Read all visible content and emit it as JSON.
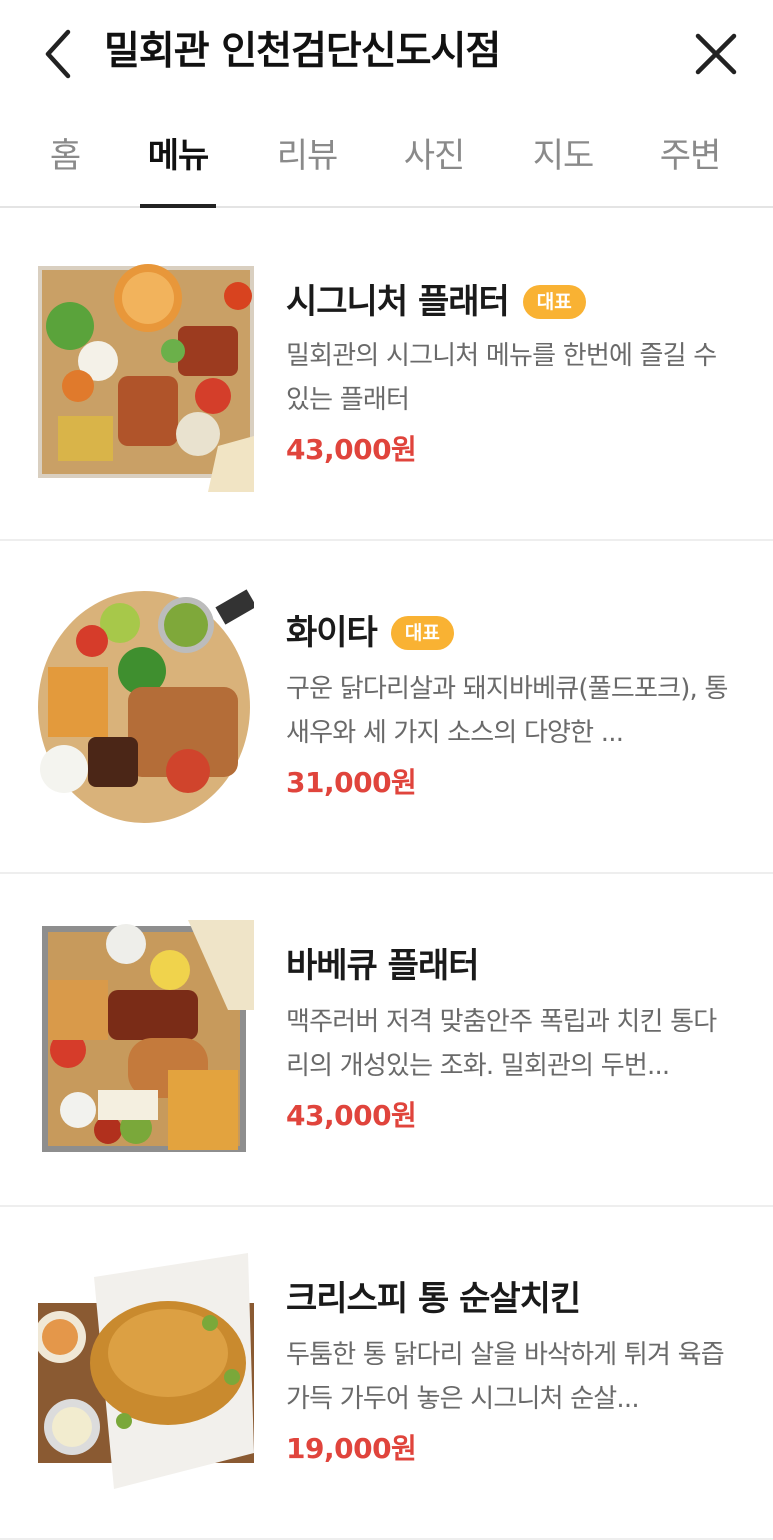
{
  "header": {
    "title": "밀회관 인천검단신도시점",
    "back_icon": "chevron-left-icon",
    "close_icon": "close-icon"
  },
  "tabs": [
    {
      "label": "홈",
      "active": false
    },
    {
      "label": "메뉴",
      "active": true
    },
    {
      "label": "리뷰",
      "active": false
    },
    {
      "label": "사진",
      "active": false
    },
    {
      "label": "지도",
      "active": false
    },
    {
      "label": "주변",
      "active": false
    }
  ],
  "menu": {
    "items": [
      {
        "name": "시그니처 플래터",
        "badge": "대표",
        "description": "밀회관의 시그니처 메뉴를 한번에 즐길 수 있는 플래터",
        "price": "43,000원"
      },
      {
        "name": "화이타",
        "badge": "대표",
        "description": "구운 닭다리살과 돼지바베큐(풀드포크), 통새우와 세 가지 소스의 다양한 ...",
        "price": "31,000원"
      },
      {
        "name": "바베큐 플래터",
        "badge": "",
        "description": "맥주러버 저격 맞춤안주 폭립과 치킨 통다리의 개성있는 조화. 밀회관의 두번...",
        "price": "43,000원"
      },
      {
        "name": "크리스피 통 순살치킨",
        "badge": "",
        "description": "두툼한 통 닭다리 살을 바삭하게 튀겨 육즙 가득 가두어 놓은 시그니처 순살...",
        "price": "19,000원"
      }
    ]
  },
  "colors": {
    "price": "#e0443c",
    "badge": "#f9b233",
    "tab_active": "#111111",
    "tab_inactive": "#8a8a8a"
  }
}
